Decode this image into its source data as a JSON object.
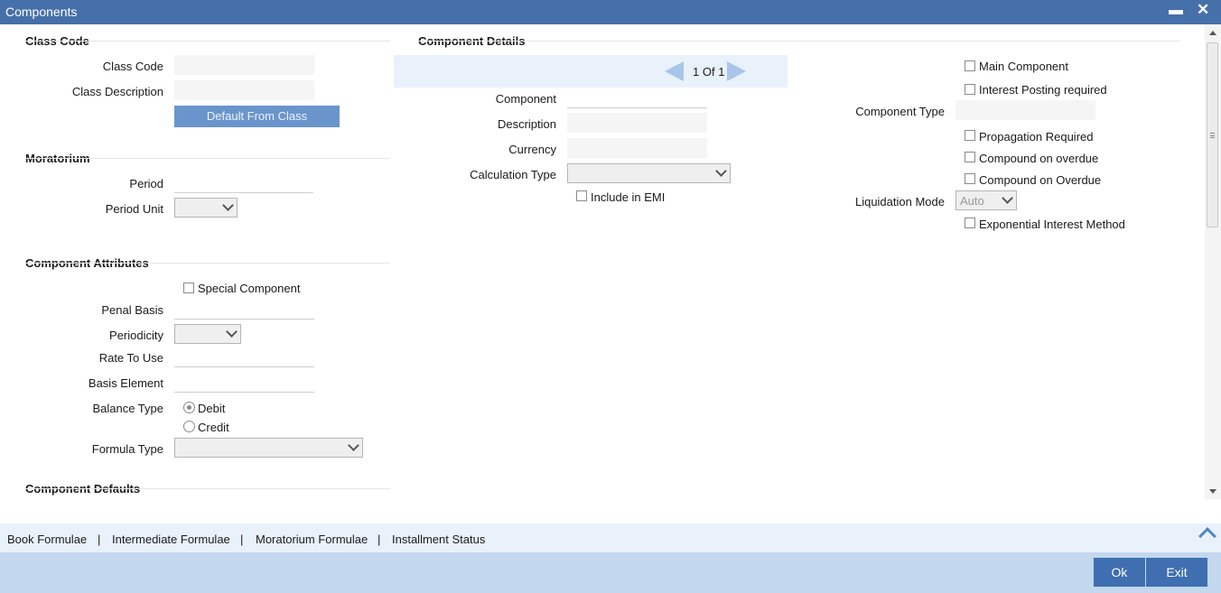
{
  "window": {
    "title": "Components",
    "minimize_glyph": "▬",
    "close_glyph": "✕"
  },
  "class_code_section": {
    "heading": "Class Code",
    "class_code_label": "Class Code",
    "class_description_label": "Class Description",
    "default_button": "Default From Class"
  },
  "moratorium": {
    "heading": "Moratorium",
    "period_label": "Period",
    "period_unit_label": "Period Unit"
  },
  "attributes": {
    "heading": "Component Attributes",
    "special_component": "Special Component",
    "penal_basis_label": "Penal Basis",
    "periodicity_label": "Periodicity",
    "rate_to_use_label": "Rate To Use",
    "basis_element_label": "Basis Element",
    "balance_type_label": "Balance Type",
    "debit": "Debit",
    "credit": "Credit",
    "formula_type_label": "Formula Type"
  },
  "defaults": {
    "heading": "Component Defaults"
  },
  "details": {
    "heading": "Component Details",
    "pager_current": "1",
    "pager_of": "Of 1",
    "component_label": "Component",
    "description_label": "Description",
    "currency_label": "Currency",
    "calculation_type_label": "Calculation Type",
    "include_in_emi": "Include in EMI"
  },
  "right": {
    "main_component": "Main Component",
    "interest_posting_required": "Interest Posting required",
    "component_type_label": "Component Type",
    "propagation_required": "Propagation Required",
    "compound_on_overdue_lower": "Compound on overdue",
    "compound_on_overdue_upper": "Compound on Overdue",
    "liquidation_mode_label": "Liquidation Mode",
    "liquidation_mode_value": "Auto",
    "exponential_interest_method": "Exponential Interest Method"
  },
  "links": {
    "book_formulae": "Book Formulae",
    "intermediate_formulae": "Intermediate Formulae",
    "moratorium_formulae": "Moratorium Formulae",
    "installment_status": "Installment Status",
    "separator": "|"
  },
  "footer": {
    "ok": "Ok",
    "exit": "Exit"
  },
  "colors": {
    "title_bar": "#4670a9",
    "footer": "#c3d7ee",
    "button": "#3f6fb0",
    "accent_band": "#e9f1fb"
  }
}
